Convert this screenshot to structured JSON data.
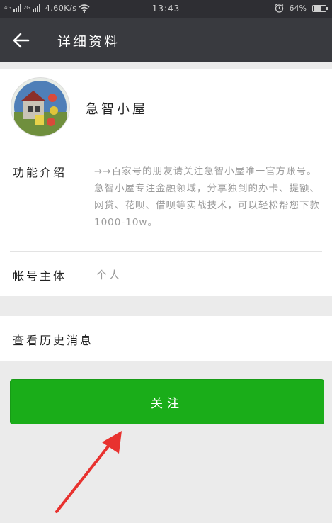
{
  "status_bar": {
    "network_left": "4G",
    "network_right": "2G",
    "speed": "4.60K/s",
    "time": "13:43",
    "battery": "64%",
    "battery_level": 0.64
  },
  "header": {
    "title": "详细资料"
  },
  "profile": {
    "name": "急智小屋"
  },
  "info": {
    "intro_label": "功能介绍",
    "intro_text": "→→百家号的朋友请关注急智小屋唯一官方账号。急智小屋专注金融领域，分享独到的办卡、提额、网贷、花呗、借呗等实战技术，可以轻松帮您下款1000-10w。",
    "owner_label": "帐号主体",
    "owner_value": "个人"
  },
  "history": {
    "label": "查看历史消息"
  },
  "actions": {
    "follow_label": "关注"
  },
  "colors": {
    "status_bar": "#2e2e33",
    "title_bar": "#393a3f",
    "background": "#ebebeb",
    "accent_green": "#1aad19",
    "arrow_red": "#e8322f"
  },
  "icons": {
    "back": "back-arrow-icon",
    "wifi": "wifi-icon",
    "alarm": "alarm-icon",
    "battery": "battery-icon"
  }
}
